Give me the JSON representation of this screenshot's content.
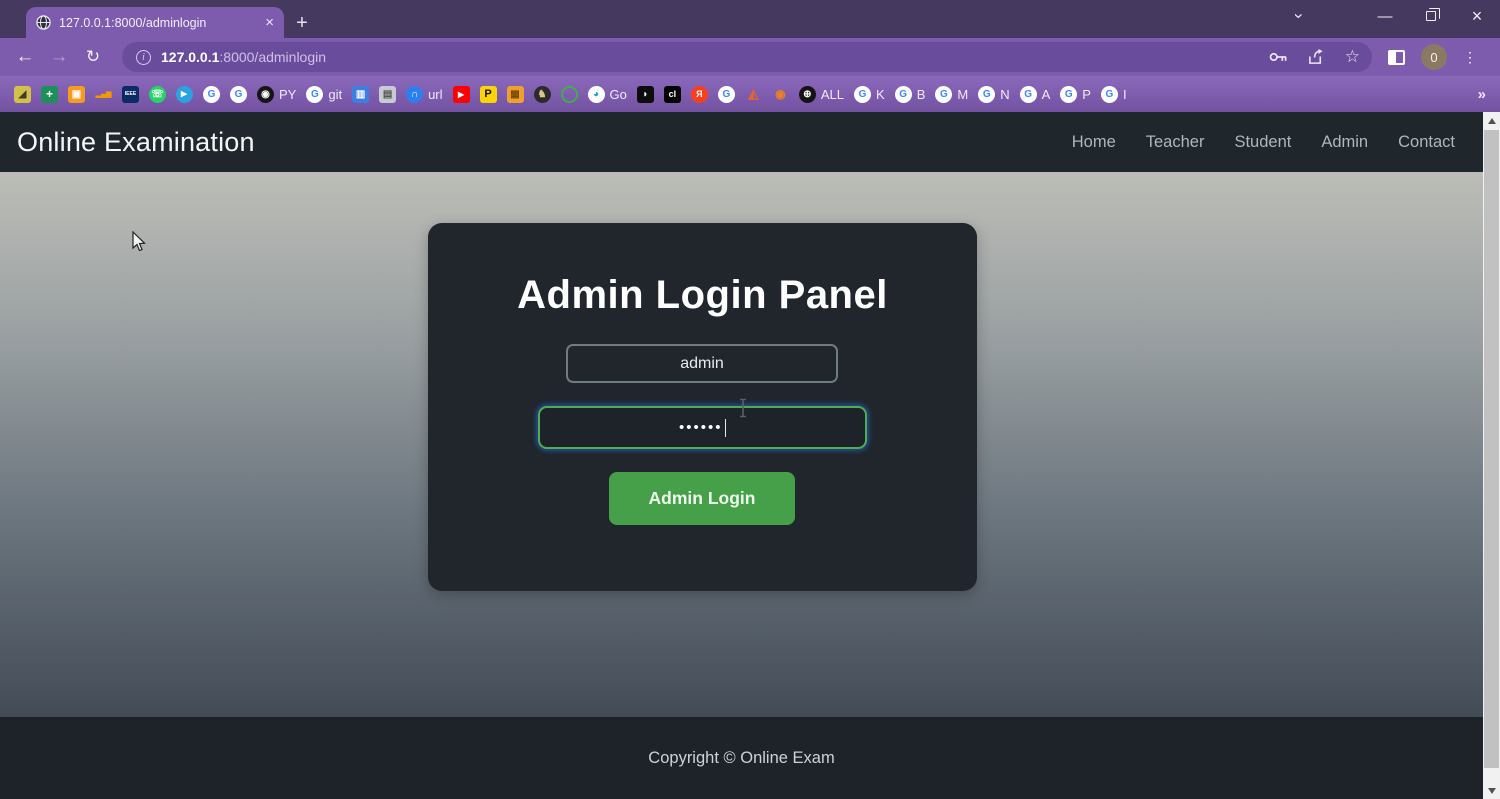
{
  "browser": {
    "tab": {
      "title": "127.0.0.1:8000/adminlogin",
      "close_glyph": "×",
      "new_tab_glyph": "+"
    },
    "window_controls": {
      "chevron": "›",
      "minimize": "—",
      "close": "×"
    },
    "toolbar": {
      "back": "←",
      "forward": "→",
      "reload": "↻",
      "url_host": "127.0.0.1",
      "url_path": ":8000/adminlogin",
      "star_glyph": "☆",
      "avatar_text": "0",
      "kebab_glyph": "⋮"
    },
    "bookmarks_overflow": "»",
    "bookmarks": [
      {
        "name": "ads",
        "shape": "sq",
        "bg": "#d2c04a",
        "fg": "#3c3c2c",
        "glyph": "◢",
        "label": ""
      },
      {
        "name": "sheets",
        "shape": "sq",
        "bg": "#1e8e5a",
        "fg": "#ffffff",
        "glyph": "+",
        "fs": 12,
        "label": ""
      },
      {
        "name": "camera",
        "shape": "sq",
        "bg": "#f59b1e",
        "fg": "#ffffff",
        "glyph": "▣",
        "label": ""
      },
      {
        "name": "analytics",
        "shape": "sq",
        "bg": "transparent",
        "fg": "#f29900",
        "glyph": "▂▄▆",
        "fs": 7,
        "label": ""
      },
      {
        "name": "ieee",
        "shape": "sq",
        "bg": "#0c2a66",
        "fg": "#ffffff",
        "glyph": "IEEE",
        "fs": 5,
        "label": ""
      },
      {
        "name": "whatsapp",
        "shape": "circle",
        "bg": "#25d366",
        "fg": "#ffffff",
        "glyph": "☏",
        "label": ""
      },
      {
        "name": "telegram",
        "shape": "circle",
        "bg": "#2aa3e0",
        "fg": "#ffffff",
        "glyph": "◀",
        "rot": "180deg",
        "fs": 8,
        "label": ""
      },
      {
        "name": "google-1",
        "shape": "circle",
        "bg": "#ffffff",
        "fg": "#4285f4",
        "glyph": "G",
        "label": ""
      },
      {
        "name": "google-2",
        "shape": "circle",
        "bg": "#ffffff",
        "fg": "#4285f4",
        "glyph": "G",
        "label": ""
      },
      {
        "name": "github",
        "shape": "circle",
        "bg": "#171515",
        "fg": "#ffffff",
        "glyph": "◉",
        "label": "PY"
      },
      {
        "name": "google-git",
        "shape": "circle",
        "bg": "#ffffff",
        "fg": "#4285f4",
        "glyph": "G",
        "label": "git"
      },
      {
        "name": "film",
        "shape": "sq",
        "bg": "#3d7fe0",
        "fg": "#ffffff",
        "glyph": "▥",
        "label": ""
      },
      {
        "name": "briefcase",
        "shape": "sq",
        "bg": "#c7cad0",
        "fg": "#555555",
        "glyph": "▤",
        "label": ""
      },
      {
        "name": "shortener",
        "shape": "circle",
        "bg": "#2d7ff0",
        "fg": "#ffffff",
        "glyph": "∩",
        "label": "url"
      },
      {
        "name": "youtube",
        "shape": "sq",
        "bg": "#ff0000",
        "fg": "#ffffff",
        "glyph": "▶",
        "fs": 8,
        "label": ""
      },
      {
        "name": "p-yellow",
        "shape": "sq",
        "bg": "#ffd400",
        "fg": "#111111",
        "glyph": "P",
        "fs": 11,
        "label": ""
      },
      {
        "name": "movie-cam",
        "shape": "sq",
        "bg": "#f0a030",
        "fg": "#7a4a00",
        "glyph": "▦",
        "label": ""
      },
      {
        "name": "dark-bird",
        "shape": "circle",
        "bg": "#2b2b2b",
        "fg": "#d8c690",
        "glyph": "♞",
        "label": ""
      },
      {
        "name": "green-ring",
        "shape": "circle",
        "bg": "transparent",
        "fg": "#3fae4a",
        "glyph": "",
        "border": "2.5px solid #3fae4a",
        "label": ""
      },
      {
        "name": "go-swirl",
        "shape": "circle",
        "bg": "#ffffff",
        "fg": "#1fa9c9",
        "glyph": "◕",
        "label": "Go"
      },
      {
        "name": "black-bird",
        "shape": "sq",
        "bg": "#0d0d0d",
        "fg": "#ffffff",
        "glyph": "◗",
        "label": ""
      },
      {
        "name": "cl",
        "shape": "sq",
        "bg": "#000000",
        "fg": "#ffffff",
        "glyph": "cl",
        "fs": 9,
        "label": ""
      },
      {
        "name": "yandex",
        "shape": "circle",
        "bg": "#fc3f1d",
        "fg": "#ffffff",
        "glyph": "Я",
        "fs": 9,
        "label": ""
      },
      {
        "name": "google-3",
        "shape": "circle",
        "bg": "#ffffff",
        "fg": "#4285f4",
        "glyph": "G",
        "label": ""
      },
      {
        "name": "matlab",
        "shape": "sq",
        "bg": "transparent",
        "fg": "#e8642a",
        "glyph": "◭",
        "fs": 13,
        "label": ""
      },
      {
        "name": "eye",
        "shape": "sq",
        "bg": "transparent",
        "fg": "#f08020",
        "glyph": "◉",
        "fs": 12,
        "label": ""
      },
      {
        "name": "globe-all",
        "shape": "circle",
        "bg": "#141414",
        "fg": "#ffffff",
        "glyph": "⊕",
        "label": "ALL"
      },
      {
        "name": "google-k",
        "shape": "circle",
        "bg": "#ffffff",
        "fg": "#4285f4",
        "glyph": "G",
        "label": "K"
      },
      {
        "name": "google-b",
        "shape": "circle",
        "bg": "#ffffff",
        "fg": "#4285f4",
        "glyph": "G",
        "label": "B"
      },
      {
        "name": "google-m",
        "shape": "circle",
        "bg": "#ffffff",
        "fg": "#4285f4",
        "glyph": "G",
        "label": "M"
      },
      {
        "name": "google-n",
        "shape": "circle",
        "bg": "#ffffff",
        "fg": "#4285f4",
        "glyph": "G",
        "label": "N"
      },
      {
        "name": "google-a",
        "shape": "circle",
        "bg": "#ffffff",
        "fg": "#4285f4",
        "glyph": "G",
        "label": "A"
      },
      {
        "name": "google-p",
        "shape": "circle",
        "bg": "#ffffff",
        "fg": "#4285f4",
        "glyph": "G",
        "label": "P"
      },
      {
        "name": "google-i",
        "shape": "circle",
        "bg": "#ffffff",
        "fg": "#4285f4",
        "glyph": "G",
        "label": "I"
      }
    ]
  },
  "page": {
    "navbar": {
      "brand": "Online Examination",
      "links": [
        "Home",
        "Teacher",
        "Student",
        "Admin",
        "Contact"
      ]
    },
    "login": {
      "title": "Admin Login Panel",
      "username_value": "admin",
      "password_dots": "••••••",
      "button_label": "Admin Login"
    },
    "footer_text": "Copyright © Online Exam"
  },
  "colors": {
    "chrome_theme": "#7d5bad",
    "chrome_frame": "#46395f",
    "site_dark": "#1f262c",
    "card_bg": "#20262b",
    "success_green": "#45a049",
    "focus_border": "#4cae50"
  }
}
